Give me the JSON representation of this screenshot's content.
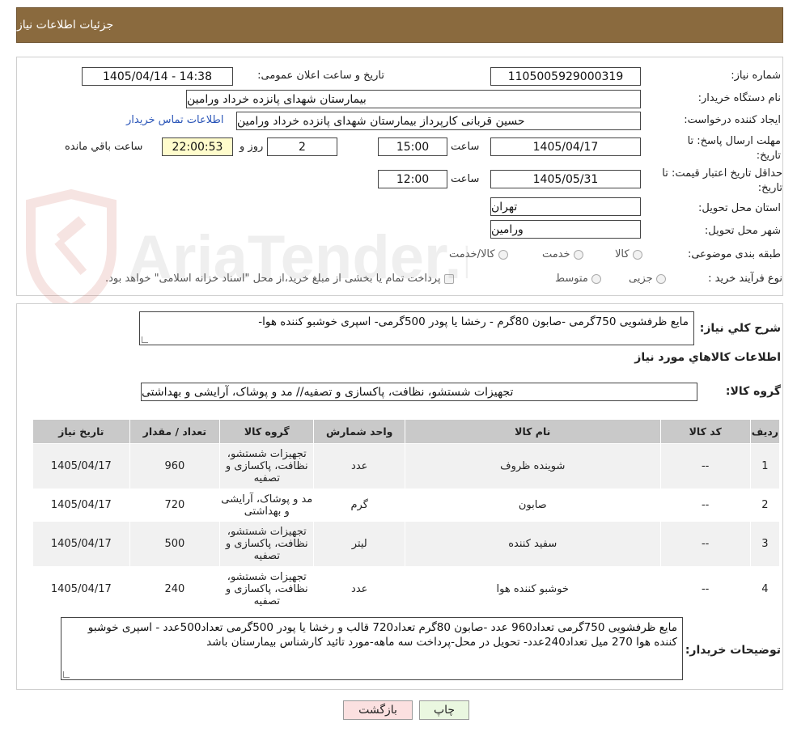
{
  "header": {
    "title": "جزئیات اطلاعات نیاز"
  },
  "form": {
    "need_number_label": "شماره نیاز:",
    "need_number": "1105005929000319",
    "announce_label": "تاریخ و ساعت اعلان عمومی:",
    "announce_value": "1405/04/14 - 14:38",
    "buyer_org_label": "نام دستگاه خریدار:",
    "buyer_org": "بیمارستان شهدای پانزده خرداد ورامین",
    "creator_label": "ایجاد کننده درخواست:",
    "creator": "حسین قربانی کارپرداز بیمارستان شهدای پانزده خرداد ورامین",
    "contact_link": "اطلاعات تماس خریدار",
    "deadline_label": "مهلت ارسال پاسخ: تا تاریخ:",
    "deadline_date": "1405/04/17",
    "time_label": "ساعت",
    "deadline_time": "15:00",
    "days_value": "2",
    "days_label": "روز و",
    "remaining_time": "22:00:53",
    "remaining_label": "ساعت باقي مانده",
    "price_validity_label": "حداقل تاریخ اعتبار قیمت: تا تاریخ:",
    "price_validity_date": "1405/05/31",
    "price_validity_time": "12:00",
    "province_label": "استان محل تحویل:",
    "province": "تهران",
    "city_label": "شهر محل تحویل:",
    "city": "ورامین",
    "category_label": "طبقه بندی موضوعی:",
    "category_options": [
      "کالا",
      "خدمت",
      "کالا/خدمت"
    ],
    "process_label": "نوع فرآیند خرید :",
    "process_options": [
      "جزیی",
      "متوسط"
    ],
    "payment_note": "پرداخت تمام یا بخشی از مبلغ خرید،از محل \"اسناد خزانه اسلامی\" خواهد بود."
  },
  "details": {
    "summary_label": "شرح کلي نياز:",
    "summary": "مایع ظرفشویی 750گرمی -صابون 80گرم - رخشا یا پودر 500گرمی- اسپری خوشبو کننده هوا-",
    "goods_info_title": "اطلاعات کالاهاي مورد نياز",
    "goods_group_label": "گروه کالا:",
    "goods_group": "تجهیزات شستشو، نظافت، پاکسازی و تصفیه// مد و پوشاک، آرایشی و بهداشتی",
    "table": {
      "headers": [
        "رديف",
        "کد کالا",
        "نام کالا",
        "واحد شمارش",
        "گروه کالا",
        "تعداد / مقدار",
        "تاریخ نیاز"
      ],
      "rows": [
        {
          "row": "1",
          "code": "--",
          "name": "شوینده ظروف",
          "unit": "عدد",
          "group": "تجهیزات شستشو، نظافت، پاکسازی و تصفیه",
          "qty": "960",
          "date": "1405/04/17"
        },
        {
          "row": "2",
          "code": "--",
          "name": "صابون",
          "unit": "گرم",
          "group": "مد و پوشاک، آرایشی و بهداشتی",
          "qty": "720",
          "date": "1405/04/17"
        },
        {
          "row": "3",
          "code": "--",
          "name": "سفید کننده",
          "unit": "لیتر",
          "group": "تجهیزات شستشو، نظافت، پاکسازی و تصفیه",
          "qty": "500",
          "date": "1405/04/17"
        },
        {
          "row": "4",
          "code": "--",
          "name": "خوشبو کننده هوا",
          "unit": "عدد",
          "group": "تجهیزات شستشو، نظافت، پاکسازی و تصفیه",
          "qty": "240",
          "date": "1405/04/17"
        }
      ]
    },
    "buyer_notes_label": "توضیحات خریدار:",
    "buyer_notes": "مایع ظرفشویی 750گرمی تعداد960 عدد -صابون 80گرم تعداد720 قالب و رخشا یا پودر 500گرمی تعداد500عدد - اسپری خوشبو کننده هوا 270 میل تعداد240عدد- تحویل در محل-پرداخت سه ماهه-مورد تائید کارشناس بیمارستان باشد"
  },
  "buttons": {
    "print": "چاپ",
    "back": "بازگشت"
  },
  "watermark": "AriaTender.neT",
  "colors": {
    "header_bg": "#8a6a3e",
    "table_header_bg": "#c9c9c9",
    "link": "#2a55b8",
    "remaining_bg": "#fffccc",
    "back_btn_bg": "#fbe0e0",
    "print_btn_bg": "#eaf7e0"
  }
}
